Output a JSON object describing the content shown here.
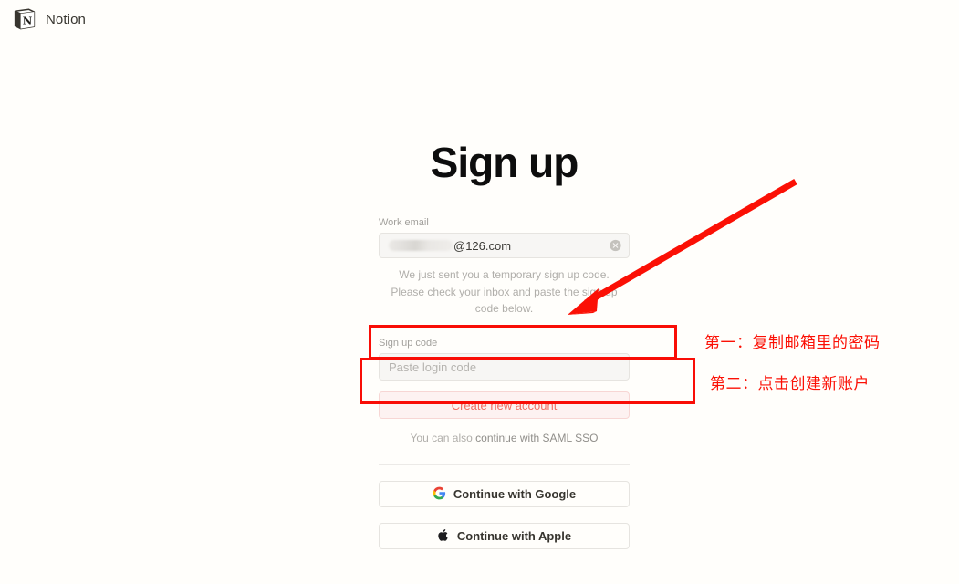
{
  "brand": {
    "name": "Notion",
    "logo_icon": "notion-cube-icon"
  },
  "page": {
    "title": "Sign up"
  },
  "email_field": {
    "label": "Work email",
    "value_suffix": "@126.com",
    "value_redacted": true,
    "clear_icon": "clear-circle-icon"
  },
  "hint": {
    "line1": "We just sent you a temporary sign up code.",
    "line2": "Please check your inbox and paste the sign up",
    "line3": "code below."
  },
  "code_field": {
    "label": "Sign up code",
    "placeholder": "Paste login code",
    "value": ""
  },
  "primary_button": {
    "label": "Create new account"
  },
  "sso": {
    "prefix": "You can also ",
    "link": "continue with SAML SSO"
  },
  "oauth": {
    "google": {
      "label": "Continue with Google",
      "icon": "google-g-icon"
    },
    "apple": {
      "label": "Continue with Apple",
      "icon": "apple-logo-icon"
    }
  },
  "annotations": {
    "step1": "第一：复制邮箱里的密码",
    "step2": "第二：点击创建新账户",
    "arrow_icon": "red-arrow-icon",
    "highlight_color": "#f90d06"
  },
  "colors": {
    "background": "#fffefb",
    "text": "#37352f",
    "muted": "#b0aeaa",
    "accent_red": "#ef6f63",
    "annotation_red": "#fb1005"
  }
}
